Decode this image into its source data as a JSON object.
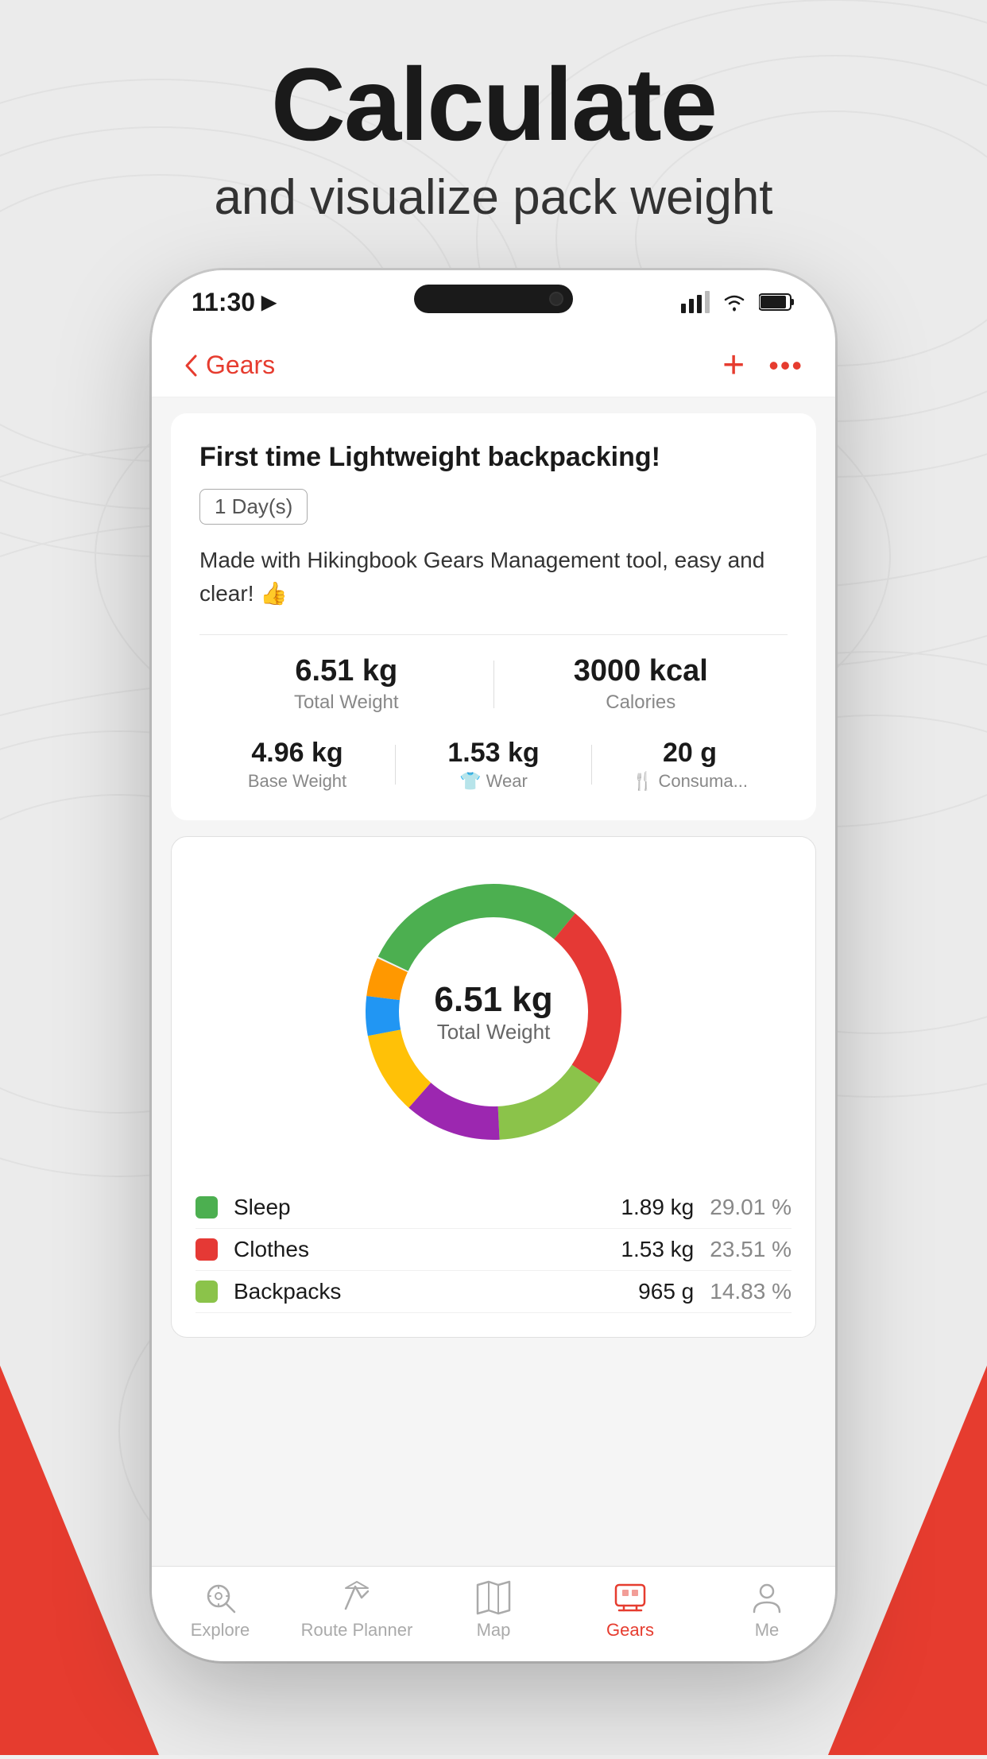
{
  "header": {
    "title": "Calculate",
    "subtitle": "and visualize pack weight"
  },
  "phone": {
    "status": {
      "time": "11:30",
      "location_icon": "▶"
    },
    "nav": {
      "back_label": "Gears",
      "add_icon": "+",
      "more_icon": "···"
    },
    "trip": {
      "title": "First time Lightweight backpacking!",
      "days_badge": "1 Day(s)",
      "description": "Made with Hikingbook Gears Management tool, easy and clear! 👍",
      "total_weight": "6.51 kg",
      "total_weight_label": "Total Weight",
      "calories": "3000 kcal",
      "calories_label": "Calories",
      "base_weight": "4.96 kg",
      "base_weight_label": "Base Weight",
      "wear_weight": "1.53 kg",
      "wear_label": "Wear",
      "consumable_weight": "20 g",
      "consumable_label": "Consuma..."
    },
    "chart": {
      "center_weight": "6.51 kg",
      "center_label": "Total Weight",
      "segments": [
        {
          "color": "#4caf50",
          "pct": 29.01,
          "startAngle": -90,
          "sweepAngle": 104
        },
        {
          "color": "#e53935",
          "pct": 23.51,
          "startAngle": 14,
          "sweepAngle": 85
        },
        {
          "color": "#8bc34a",
          "pct": 14.83,
          "startAngle": 99,
          "sweepAngle": 53
        },
        {
          "color": "#9c27b0",
          "pct": 12.3,
          "startAngle": 152,
          "sweepAngle": 44
        },
        {
          "color": "#ffc107",
          "pct": 10.5,
          "startAngle": 196,
          "sweepAngle": 38
        },
        {
          "color": "#2196f3",
          "pct": 5.0,
          "startAngle": 234,
          "sweepAngle": 18
        },
        {
          "color": "#ff9800",
          "pct": 4.85,
          "startAngle": 252,
          "sweepAngle": 17
        }
      ],
      "legend": [
        {
          "color": "#4caf50",
          "name": "Sleep",
          "weight": "1.89 kg",
          "pct": "29.01 %"
        },
        {
          "color": "#e53935",
          "name": "Clothes",
          "weight": "1.53 kg",
          "pct": "23.51 %"
        },
        {
          "color": "#8bc34a",
          "name": "Backpacks",
          "weight": "965 g",
          "pct": "14.83 %"
        }
      ]
    },
    "tabs": [
      {
        "label": "Explore",
        "icon": "explore",
        "active": false
      },
      {
        "label": "Route Planner",
        "icon": "route",
        "active": false
      },
      {
        "label": "Map",
        "icon": "map",
        "active": false
      },
      {
        "label": "Gears",
        "icon": "gears",
        "active": true
      },
      {
        "label": "Me",
        "icon": "me",
        "active": false
      }
    ]
  }
}
